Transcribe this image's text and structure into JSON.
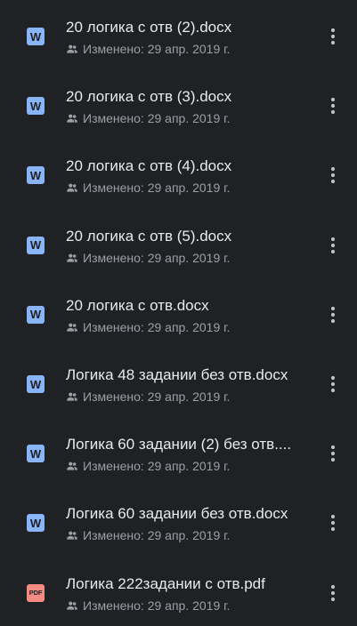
{
  "colors": {
    "background": "#202124",
    "word_icon": "#8ab4f8",
    "pdf_icon": "#f28b82",
    "primary_text": "#e8eaed",
    "secondary_text": "#9aa0a6"
  },
  "files": [
    {
      "name": "20 логика с отв (2).docx",
      "type": "word",
      "icon_label": "W",
      "icon_name": "word-doc-icon",
      "shared_icon": "people-icon",
      "modified": "Изменено: 29 апр. 2019 г."
    },
    {
      "name": "20 логика с отв (3).docx",
      "type": "word",
      "icon_label": "W",
      "icon_name": "word-doc-icon",
      "shared_icon": "people-icon",
      "modified": "Изменено: 29 апр. 2019 г."
    },
    {
      "name": "20 логика с отв (4).docx",
      "type": "word",
      "icon_label": "W",
      "icon_name": "word-doc-icon",
      "shared_icon": "people-icon",
      "modified": "Изменено: 29 апр. 2019 г."
    },
    {
      "name": "20 логика с отв (5).docx",
      "type": "word",
      "icon_label": "W",
      "icon_name": "word-doc-icon",
      "shared_icon": "people-icon",
      "modified": "Изменено: 29 апр. 2019 г."
    },
    {
      "name": "20 логика с отв.docx",
      "type": "word",
      "icon_label": "W",
      "icon_name": "word-doc-icon",
      "shared_icon": "people-icon",
      "modified": "Изменено: 29 апр. 2019 г."
    },
    {
      "name": "Логика 48 задании без отв.docx",
      "type": "word",
      "icon_label": "W",
      "icon_name": "word-doc-icon",
      "shared_icon": "people-icon",
      "modified": "Изменено: 29 апр. 2019 г."
    },
    {
      "name": "Логика 60 задании (2) без отв....",
      "type": "word",
      "icon_label": "W",
      "icon_name": "word-doc-icon",
      "shared_icon": "people-icon",
      "modified": "Изменено: 29 апр. 2019 г."
    },
    {
      "name": "Логика 60 задании без отв.docx",
      "type": "word",
      "icon_label": "W",
      "icon_name": "word-doc-icon",
      "shared_icon": "people-icon",
      "modified": "Изменено: 29 апр. 2019 г."
    },
    {
      "name": "Логика 222задании с отв.pdf",
      "type": "pdf",
      "icon_label": "PDF",
      "icon_name": "pdf-doc-icon",
      "shared_icon": "people-icon",
      "modified": "Изменено: 29 апр. 2019 г."
    }
  ],
  "more_icon": "more-vert-icon"
}
